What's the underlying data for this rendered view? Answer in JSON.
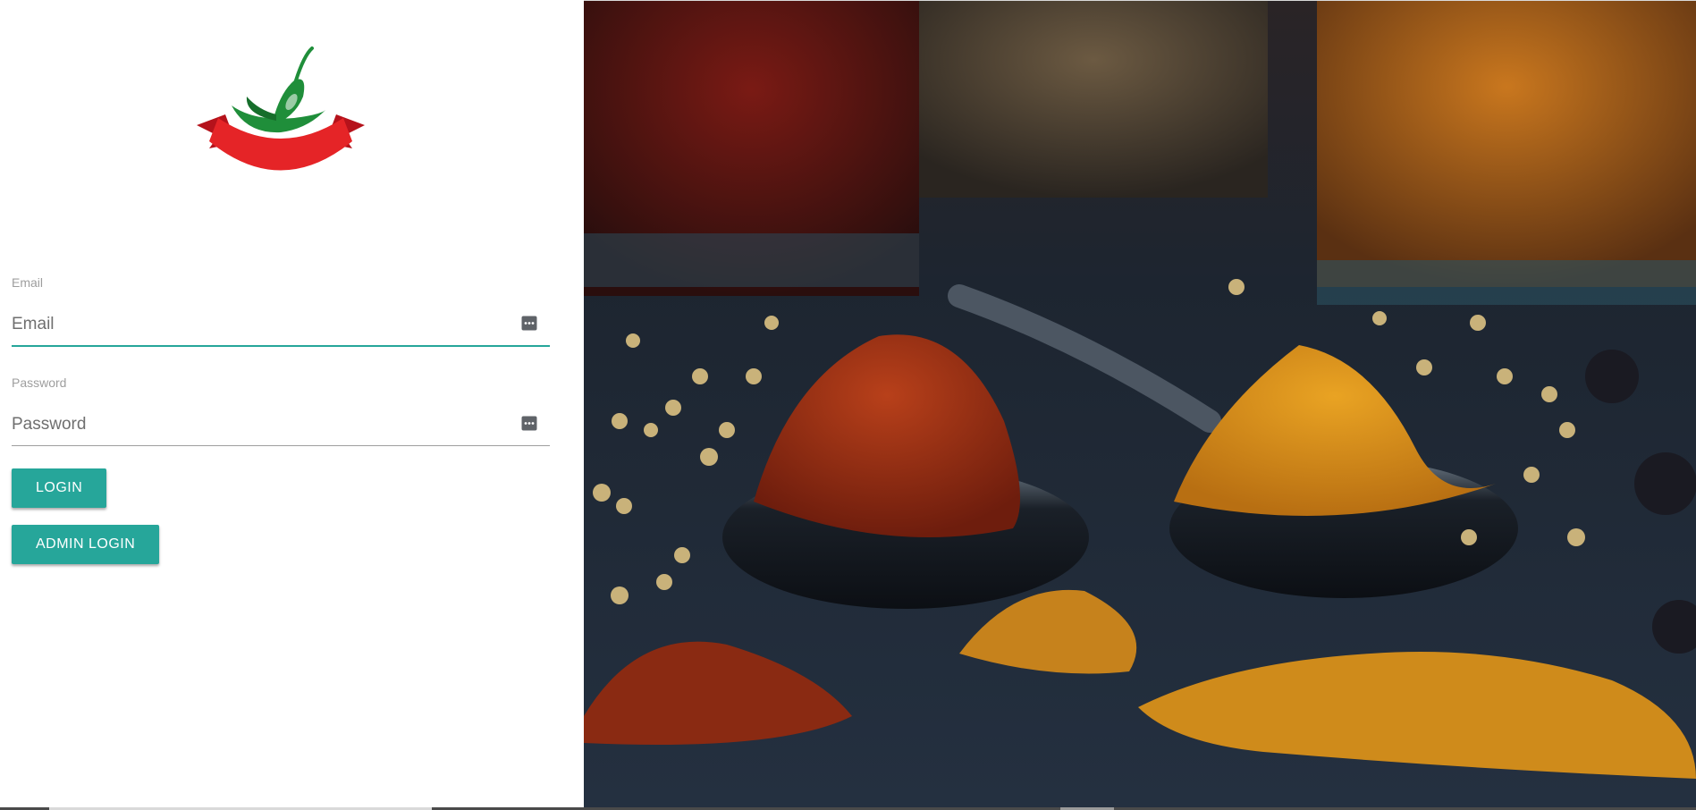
{
  "brand": {
    "logo_icon": "chili-pepper-ribbon-logo",
    "accent_color": "#26a69a"
  },
  "email": {
    "label": "Email",
    "placeholder": "Email",
    "value": "",
    "icon": "password-manager-icon"
  },
  "password": {
    "label": "Password",
    "placeholder": "Password",
    "value": "",
    "icon": "password-manager-icon"
  },
  "buttons": {
    "login": "LOGIN",
    "admin_login": "ADMIN LOGIN"
  },
  "hero": {
    "image": "spices-on-spoons-photo"
  }
}
